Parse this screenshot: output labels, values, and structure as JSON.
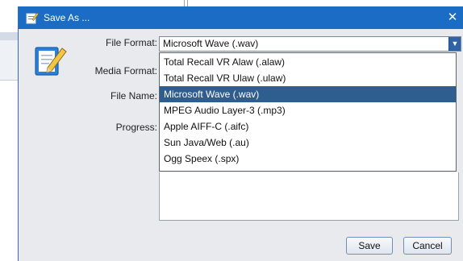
{
  "dialog": {
    "title": "Save As ...",
    "close_glyph": "✕",
    "title_icon": "save-as-icon",
    "main_icon": "edit-document-icon"
  },
  "form": {
    "file_format_label": "File Format:",
    "media_format_label": "Media Format:",
    "file_name_label": "File Name:",
    "progress_label": "Progress:",
    "file_format_value": "Microsoft Wave (.wav)",
    "combo_arrow_glyph": "▼"
  },
  "dropdown": {
    "options": [
      "Total Recall VR Alaw (.alaw)",
      "Total Recall VR Ulaw (.ulaw)",
      "Microsoft Wave (.wav)",
      "MPEG Audio Layer-3 (.mp3)",
      "Apple AIFF-C (.aifc)",
      "Sun Java/Web (.au)",
      "Ogg Speex (.spx)"
    ],
    "selected_index": 2
  },
  "buttons": {
    "save_label": "Save",
    "cancel_label": "Cancel"
  },
  "colors": {
    "titlebar": "#1a6cc4",
    "selection": "#2e5d8f",
    "dialog_bg": "#e8eaed"
  }
}
